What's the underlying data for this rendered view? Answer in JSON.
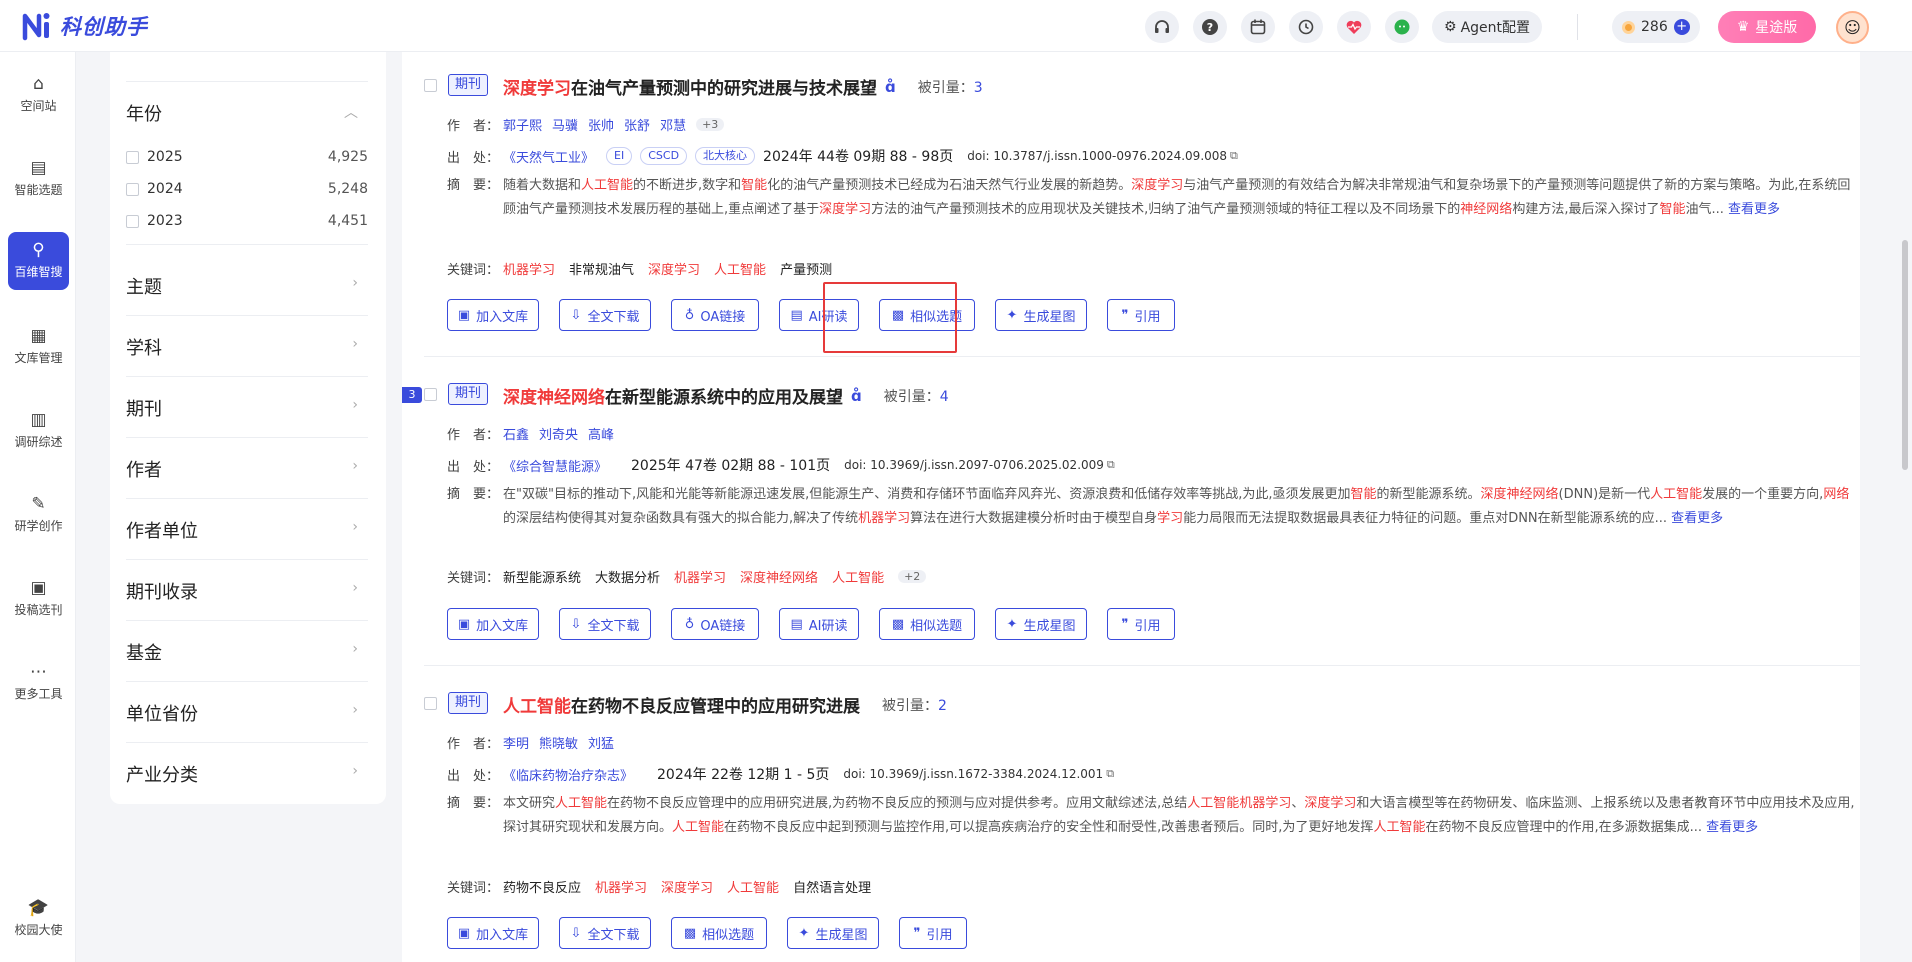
{
  "app": {
    "name": "科创助手"
  },
  "topbar": {
    "icons": [
      "headset-icon",
      "help-icon",
      "calendar-icon",
      "history-icon",
      "heart-pulse-icon",
      "wechat-icon"
    ],
    "agent_label": "Agent配置",
    "credits": "286",
    "vip_label": "星途版"
  },
  "leftnav": [
    {
      "label": "空间站",
      "icon": "⌂"
    },
    {
      "label": "智能选题",
      "icon": "▤"
    },
    {
      "label": "百维智搜",
      "icon": "⚲"
    },
    {
      "label": "文库管理",
      "icon": "▦"
    },
    {
      "label": "调研综述",
      "icon": "▥"
    },
    {
      "label": "研学创作",
      "icon": "✎"
    },
    {
      "label": "投稿选刊",
      "icon": "▣"
    },
    {
      "label": "更多工具",
      "icon": "⋯"
    },
    {
      "label": "校园大使",
      "icon": "🎓"
    }
  ],
  "filter": {
    "year_title": "年份",
    "years": [
      {
        "label": "2025",
        "count": "4,925"
      },
      {
        "label": "2024",
        "count": "5,248"
      },
      {
        "label": "2023",
        "count": "4,451"
      }
    ],
    "sections": [
      "主题",
      "学科",
      "期刊",
      "作者",
      "作者单位",
      "期刊收录",
      "基金",
      "单位省份",
      "产业分类"
    ]
  },
  "labels": {
    "author": "作　者：",
    "source": "出　处：",
    "abstract": "摘　要：",
    "keywords": "关键词：",
    "cited": "被引量：",
    "read_more": "查看更多"
  },
  "articles": [
    {
      "type": "期刊",
      "title_hl": "深度学习",
      "title_rest": "在油气产量预测中的研究进展与技术展望",
      "cited": "3",
      "authors": [
        "郭子熙",
        "马骥",
        "张帅",
        "张舒",
        "邓慧"
      ],
      "authors_more": "+3",
      "source": "《天然气工业》",
      "tags": [
        "EI",
        "CSCD",
        "北大核心"
      ],
      "volume": "2024年 44卷 09期 88 - 98页",
      "doi": "doi: 10.3787/j.issn.1000-0976.2024.09.008",
      "abstract_parts": [
        [
          "随着大数据和",
          false
        ],
        [
          "人工智能",
          true
        ],
        [
          "的不断进步,数字和",
          false
        ],
        [
          "智能",
          true
        ],
        [
          "化的油气产量预测技术已经成为石油天然气行业发展的新趋势。",
          false
        ],
        [
          "深度学习",
          true
        ],
        [
          "与油气产量预测的有效结合为解决非常规油气和复杂场景下的产量预测等问题提供了新的方案与策略。为此,在系统回顾油气产量预测技术发展历程的基础上,重点阐述了基于",
          false
        ],
        [
          "深度学习",
          true
        ],
        [
          "方法的油气产量预测技术的应用现状及关键技术,归纳了油气产量预测领域的特征工程以及不同场景下的",
          false
        ],
        [
          "神经网络",
          true
        ],
        [
          "构建方法,最后深入探讨了",
          false
        ],
        [
          "智能",
          true
        ],
        [
          "油气...",
          false
        ]
      ],
      "keywords": [
        [
          "机器学习",
          true
        ],
        [
          "非常规油气",
          false
        ],
        [
          "深度学习",
          true
        ],
        [
          "人工智能",
          true
        ],
        [
          "产量预测",
          false
        ]
      ],
      "buttons": [
        "加入文库",
        "全文下载",
        "OA链接",
        "AI研读",
        "相似选题",
        "生成星图",
        "引用"
      ]
    },
    {
      "index": "3",
      "type": "期刊",
      "title_hl": "深度神经网络",
      "title_rest": "在新型能源系统中的应用及展望",
      "cited": "4",
      "authors": [
        "石鑫",
        "刘奇央",
        "高峰"
      ],
      "source": "《综合智慧能源》",
      "volume": "2025年 47卷 02期 88 - 101页",
      "doi": "doi: 10.3969/j.issn.2097-0706.2025.02.009",
      "abstract_parts": [
        [
          "在\"双碳\"目标的推动下,风能和光能等新能源迅速发展,但能源生产、消费和存储环节面临弃风弃光、资源浪费和低储存效率等挑战,为此,亟须发展更加",
          false
        ],
        [
          "智能",
          true
        ],
        [
          "的新型能源系统。",
          false
        ],
        [
          "深度神经网络",
          true
        ],
        [
          "(DNN)是新一代",
          false
        ],
        [
          "人工智能",
          true
        ],
        [
          "发展的一个重要方向,",
          false
        ],
        [
          "网络",
          true
        ],
        [
          "的深层结构使得其对复杂函数具有强大的拟合能力,解决了传统",
          false
        ],
        [
          "机器学习",
          true
        ],
        [
          "算法在进行大数据建模分析时由于模型自身",
          false
        ],
        [
          "学习",
          true
        ],
        [
          "能力局限而无法提取数据最具表征力特征的问题。重点对DNN在新型能源系统的应...",
          false
        ]
      ],
      "keywords": [
        [
          "新型能源系统",
          false
        ],
        [
          "大数据分析",
          false
        ],
        [
          "机器学习",
          true
        ],
        [
          "深度神经网络",
          true
        ],
        [
          "人工智能",
          true
        ]
      ],
      "keywords_more": "+2",
      "buttons": [
        "加入文库",
        "全文下载",
        "OA链接",
        "AI研读",
        "相似选题",
        "生成星图",
        "引用"
      ]
    },
    {
      "type": "期刊",
      "title_hl": "人工智能",
      "title_rest": "在药物不良反应管理中的应用研究进展",
      "cited": "2",
      "authors": [
        "李明",
        "熊晓敏",
        "刘猛"
      ],
      "source": "《临床药物治疗杂志》",
      "volume": "2024年 22卷 12期 1 - 5页",
      "doi": "doi: 10.3969/j.issn.1672-3384.2024.12.001",
      "abstract_parts": [
        [
          "本文研究",
          false
        ],
        [
          "人工智能",
          true
        ],
        [
          "在药物不良反应管理中的应用研究进展,为药物不良反应的预测与应对提供参考。应用文献综述法,总结",
          false
        ],
        [
          "人工智能",
          true
        ],
        [
          "机器学习",
          true
        ],
        [
          "、",
          false
        ],
        [
          "深度学习",
          true
        ],
        [
          "和大语言模型等在药物研发、临床监测、上报系统以及患者教育环节中应用技术及应用,探讨其研究现状和发展方向。",
          false
        ],
        [
          "人工智能",
          true
        ],
        [
          "在药物不良反应中起到预测与监控作用,可以提高疾病治疗的安全性和耐受性,改善患者预后。同时,为了更好地发挥",
          false
        ],
        [
          "人工智能",
          true
        ],
        [
          "在药物不良反应管理中的作用,在多源数据集成...",
          false
        ]
      ],
      "keywords": [
        [
          "药物不良反应",
          false
        ],
        [
          "机器学习",
          true
        ],
        [
          "深度学习",
          true
        ],
        [
          "人工智能",
          true
        ],
        [
          "自然语言处理",
          false
        ]
      ],
      "buttons": [
        "加入文库",
        "全文下载",
        "相似选题",
        "生成星图",
        "引用"
      ]
    }
  ],
  "colors": {
    "accent": "#3a4bdc",
    "highlight": "#f03a3a",
    "vip": "#ff6aa8"
  }
}
